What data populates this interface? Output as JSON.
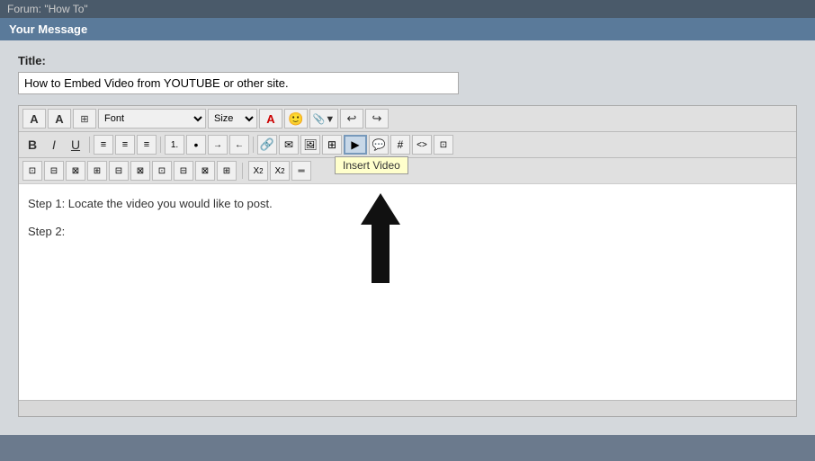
{
  "forum_bar": {
    "text": "Forum: \"How To\""
  },
  "header": {
    "title": "Your Message"
  },
  "form": {
    "title_label": "Title:",
    "title_value": "How to Embed Video from YOUTUBE or other site."
  },
  "toolbar": {
    "row1": {
      "font_label": "Font",
      "size_label": "Size",
      "undo_label": "↩",
      "redo_label": "↪"
    },
    "row2": {
      "bold": "B",
      "italic": "I",
      "underline": "U",
      "align_left": "≡",
      "align_center": "≡",
      "align_right": "≡",
      "ol": "1.",
      "ul": "•",
      "indent": "→",
      "outdent": "←",
      "hash": "#",
      "code": "<>",
      "image_btn": "🖼"
    },
    "insert_video_tooltip": "Insert Video"
  },
  "content": {
    "line1": "Step 1: Locate the video you would like to post.",
    "line2": "Step 2:"
  },
  "colors": {
    "accent": "#5a7a9a",
    "toolbar_bg": "#e0e0e0",
    "editor_bg": "#fff",
    "arrow_color": "#111"
  }
}
